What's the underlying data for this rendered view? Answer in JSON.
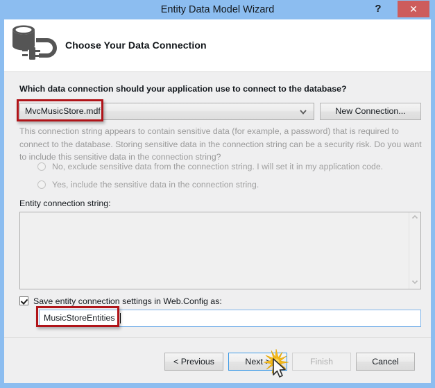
{
  "window": {
    "title": "Entity Data Model Wizard",
    "help_label": "?",
    "close_label": "✕"
  },
  "header": {
    "icon": "database-connection-icon",
    "title": "Choose Your Data Connection"
  },
  "main": {
    "question_label": "Which data connection should your application use to connect to the database?",
    "connection_select": {
      "value": "MvcMusicStore.mdf",
      "arrow": "chevron-down-icon"
    },
    "new_connection_label": "New Connection...",
    "sensitive_text": "This connection string appears to contain sensitive data (for example, a password) that is required to connect to the database. Storing sensitive data in the connection string can be a security risk. Do you want to include this sensitive data in the connection string?",
    "radio_no_label": "No, exclude sensitive data from the connection string. I will set it in my application code.",
    "radio_yes_label": "Yes, include the sensitive data in the connection string.",
    "entity_connection_string_label": "Entity connection string:",
    "entity_connection_string_value": "",
    "scrollbar_up": "▲",
    "scrollbar_down": "▼",
    "save_settings_label": "Save entity connection settings in Web.Config as:",
    "entities_name_value": "MusicStoreEntities"
  },
  "footer": {
    "previous_label": "< Previous",
    "next_label": "Next >",
    "finish_label": "Finish",
    "cancel_label": "Cancel"
  },
  "colors": {
    "titlebar": "#8cbdf0",
    "close_button": "#cd5c5c",
    "body_background": "#efeff0",
    "annotation_red": "#b01419",
    "focus_blue": "#3c9ae6",
    "burst_yellow": "#f5b91a"
  }
}
